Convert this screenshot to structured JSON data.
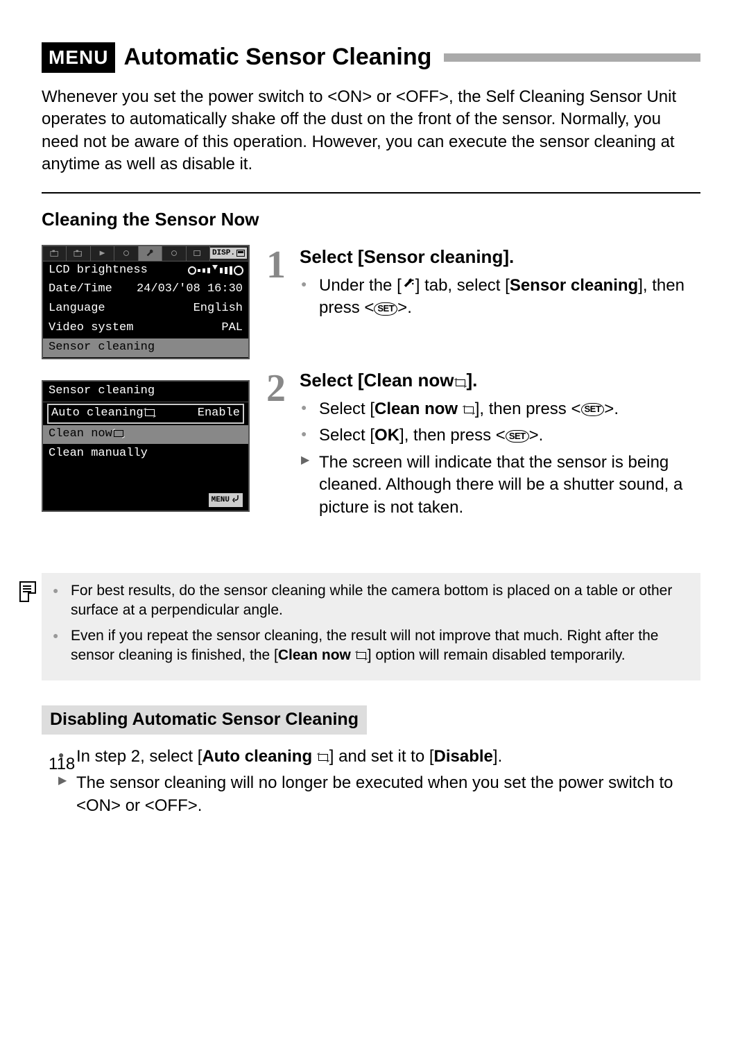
{
  "header": {
    "menu_badge": "MENU",
    "title": "Automatic Sensor Cleaning"
  },
  "intro": {
    "t1": "Whenever you set the power switch to <",
    "on": "ON",
    "t2": "> or <",
    "off": "OFF",
    "t3": ">, the Self Cleaning Sensor Unit operates to automatically shake off the dust on the front of the sensor. Normally, you need not be aware of this operation. However, you can execute the sensor cleaning at anytime as well as disable it."
  },
  "section1_heading": "Cleaning the Sensor Now",
  "screen1": {
    "disp_label": "DISP.",
    "rows": {
      "r0_label": "LCD brightness",
      "r1_label": "Date/Time",
      "r1_value": "24/03/'08 16:30",
      "r2_label": "Language",
      "r2_value": "English",
      "r3_label": "Video system",
      "r3_value": "PAL",
      "r4_label": "Sensor cleaning"
    }
  },
  "screen2": {
    "title": "Sensor cleaning",
    "r0_label": "Auto cleaning",
    "r0_value": "Enable",
    "r1_label": "Clean now",
    "r2_label": "Clean manually",
    "menu_label": "MENU"
  },
  "step1": {
    "num": "1",
    "title": "Select [Sensor cleaning].",
    "b1a": "Under the [",
    "b1b": "] tab, select [",
    "b1c": "Sensor cleaning",
    "b1d": "], then press <",
    "b1e": ">.",
    "set": "SET"
  },
  "step2": {
    "num": "2",
    "title_a": "Select [Clean now",
    "title_b": "].",
    "b1a": "Select [",
    "b1b": "Clean now",
    "b1c": "], then press <",
    "b1d": ">.",
    "b2a": "Select [",
    "b2b": "OK",
    "b2c": "], then press <",
    "b2d": ">.",
    "b3": "The screen will indicate that the sensor is being cleaned. Although there will be a shutter sound, a picture is not taken.",
    "set": "SET"
  },
  "notes": {
    "n1": "For best results, do the sensor cleaning while the camera bottom is placed on a table or other surface at a perpendicular angle.",
    "n2a": "Even if you repeat the sensor cleaning, the result will not improve that much. Right after the sensor cleaning is finished, the [",
    "n2b": "Clean now",
    "n2c": "] option will remain disabled temporarily."
  },
  "section2": {
    "heading": "Disabling Automatic Sensor Cleaning",
    "b1a": "In step 2, select [",
    "b1b": "Auto cleaning",
    "b1c": "] and set it to [",
    "b1d": "Disable",
    "b1e": "].",
    "b2a": "The sensor cleaning will no longer be executed when you set the power switch to <",
    "on": "ON",
    "b2b": "> or <",
    "off": "OFF",
    "b2c": ">."
  },
  "page_num": "118"
}
